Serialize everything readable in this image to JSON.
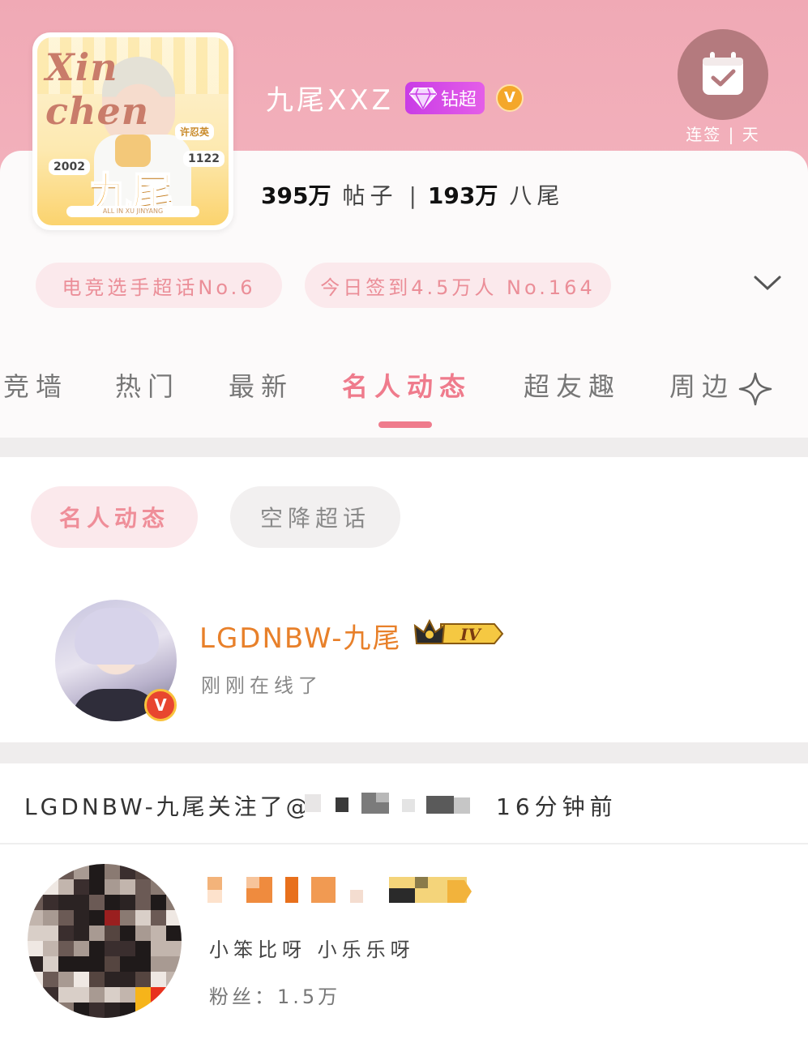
{
  "header": {
    "title": "九尾XXZ",
    "diamond_label": "钻超",
    "verified_label": "V",
    "checkin_label": "连签 | 天",
    "avatar_art": {
      "script_text": "Xin chen",
      "big_text": "九尾",
      "tag_left": "2002",
      "tag_right": "1122",
      "tag_top": "许忍英",
      "bottom_text": "ALL IN XU JINYANG"
    }
  },
  "stats": {
    "posts_value": "395万",
    "posts_label": "帖子",
    "fans_value": "193万",
    "fans_label": "八尾",
    "separator": "|"
  },
  "pills": {
    "rank": "电竞选手超话No.6",
    "checkin_today": "今日签到4.5万人 No.164"
  },
  "tabs": [
    {
      "label": "竞墙",
      "active": false
    },
    {
      "label": "热门",
      "active": false
    },
    {
      "label": "最新",
      "active": false
    },
    {
      "label": "名人动态",
      "active": true
    },
    {
      "label": "超友趣",
      "active": false
    },
    {
      "label": "周边",
      "active": false
    }
  ],
  "subtabs": [
    {
      "label": "名人动态",
      "active": true
    },
    {
      "label": "空降超话",
      "active": false
    }
  ],
  "celebrity": {
    "name": "LGDNBW-九尾",
    "level": "IV",
    "status": "刚刚在线了",
    "verified_label": "V"
  },
  "activity": {
    "text": "LGDNBW-九尾关注了@",
    "time": "16分钟前"
  },
  "followed_user": {
    "description": "小笨比呀 小乐乐呀",
    "followers": "粉丝：1.5万"
  },
  "colors": {
    "header_pink": "#f0a9b5",
    "accent_pink": "#ef7b8c",
    "pill_bg": "#fbe9ec",
    "name_orange": "#e8802a",
    "diamond_purple": "#c93ce6",
    "verified_orange": "#f4a72a",
    "verified_red": "#e8462f"
  },
  "icons": {
    "checkin": "calendar-check-icon",
    "expand": "chevron-down-icon",
    "sparkle": "sparkle-icon",
    "diamond": "diamond-icon",
    "crown": "crown-icon"
  }
}
